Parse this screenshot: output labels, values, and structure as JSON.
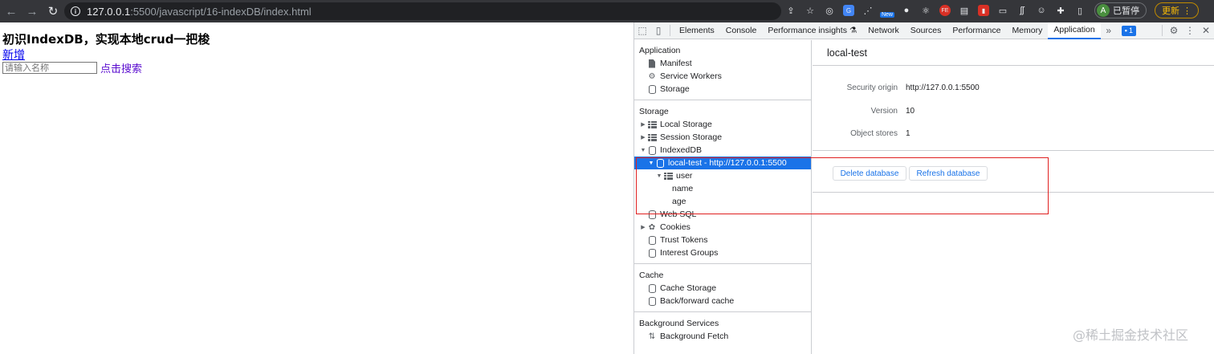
{
  "browser": {
    "url_host": "127.0.0.1",
    "url_path": ":5500/javascript/16-indexDB/index.html",
    "extension_badge": "New",
    "profile_label": "已暂停",
    "avatar_initial": "A",
    "update_label": "更新"
  },
  "page": {
    "heading": "初识IndexDB，实现本地crud一把梭",
    "add_link": "新增",
    "search_placeholder": "请输入名称",
    "search_link": "点击搜索"
  },
  "devtools": {
    "tabs": [
      "Elements",
      "Console",
      "Performance insights ⚗",
      "Network",
      "Sources",
      "Performance",
      "Memory",
      "Application"
    ],
    "selected_tab": "Application",
    "issues_count": "1",
    "sidebar": {
      "application": {
        "title": "Application",
        "items": [
          "Manifest",
          "Service Workers",
          "Storage"
        ]
      },
      "storage": {
        "title": "Storage",
        "local_storage": "Local Storage",
        "session_storage": "Session Storage",
        "indexeddb": "IndexedDB",
        "db_entry": "local-test - http://127.0.0.1:5500",
        "store": "user",
        "index_name": "name",
        "index_age": "age",
        "web_sql": "Web SQL",
        "cookies": "Cookies",
        "trust_tokens": "Trust Tokens",
        "interest_groups": "Interest Groups"
      },
      "cache": {
        "title": "Cache",
        "cache_storage": "Cache Storage",
        "bf_cache": "Back/forward cache"
      },
      "background": {
        "title": "Background Services",
        "fetch": "Background Fetch"
      }
    },
    "main": {
      "db_name": "local-test",
      "security_origin_label": "Security origin",
      "security_origin_value": "http://127.0.0.1:5500",
      "version_label": "Version",
      "version_value": "10",
      "object_stores_label": "Object stores",
      "object_stores_value": "1",
      "delete_label": "Delete database",
      "refresh_label": "Refresh database"
    }
  },
  "watermark": "@稀土掘金技术社区",
  "colors": {
    "accent": "#1a73e8",
    "highlight": "#e02020"
  }
}
